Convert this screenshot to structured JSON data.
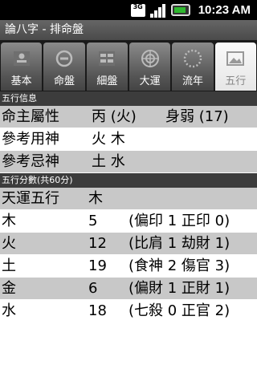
{
  "status_bar": {
    "network": "3G",
    "time": "10:23 AM"
  },
  "app": {
    "title": "論八字 - 排命盤"
  },
  "tabs": [
    {
      "label": "基本",
      "icon": "person-icon",
      "active": false
    },
    {
      "label": "命盤",
      "icon": "circle-minus-icon",
      "active": false
    },
    {
      "label": "細盤",
      "icon": "grid-icon",
      "active": false
    },
    {
      "label": "大運",
      "icon": "compass-icon",
      "active": false
    },
    {
      "label": "流年",
      "icon": "dotted-circle-icon",
      "active": false
    },
    {
      "label": "五行",
      "icon": "landscape-icon",
      "active": true
    }
  ],
  "info_section": {
    "header": "五行信息",
    "rows": [
      {
        "label": "命主屬性",
        "value": "丙 (火)",
        "extra": "身弱 (17)"
      },
      {
        "label": "參考用神",
        "value": "火 木",
        "extra": ""
      },
      {
        "label": "參考忌神",
        "value": "土 水",
        "extra": ""
      }
    ]
  },
  "score_section": {
    "header": "五行分數(共60分)",
    "fortune_row": {
      "label": "天運五行",
      "value": "木"
    },
    "rows": [
      {
        "element": "木",
        "score": "5",
        "detail": "(偏印 1 正印 0)"
      },
      {
        "element": "火",
        "score": "12",
        "detail": "(比肩 1 劫財 1)"
      },
      {
        "element": "土",
        "score": "19",
        "detail": "(食神 2 傷官 3)"
      },
      {
        "element": "金",
        "score": "6",
        "detail": "(偏財 1 正財 1)"
      },
      {
        "element": "水",
        "score": "18",
        "detail": "(七殺 0 正官 2)"
      }
    ]
  }
}
